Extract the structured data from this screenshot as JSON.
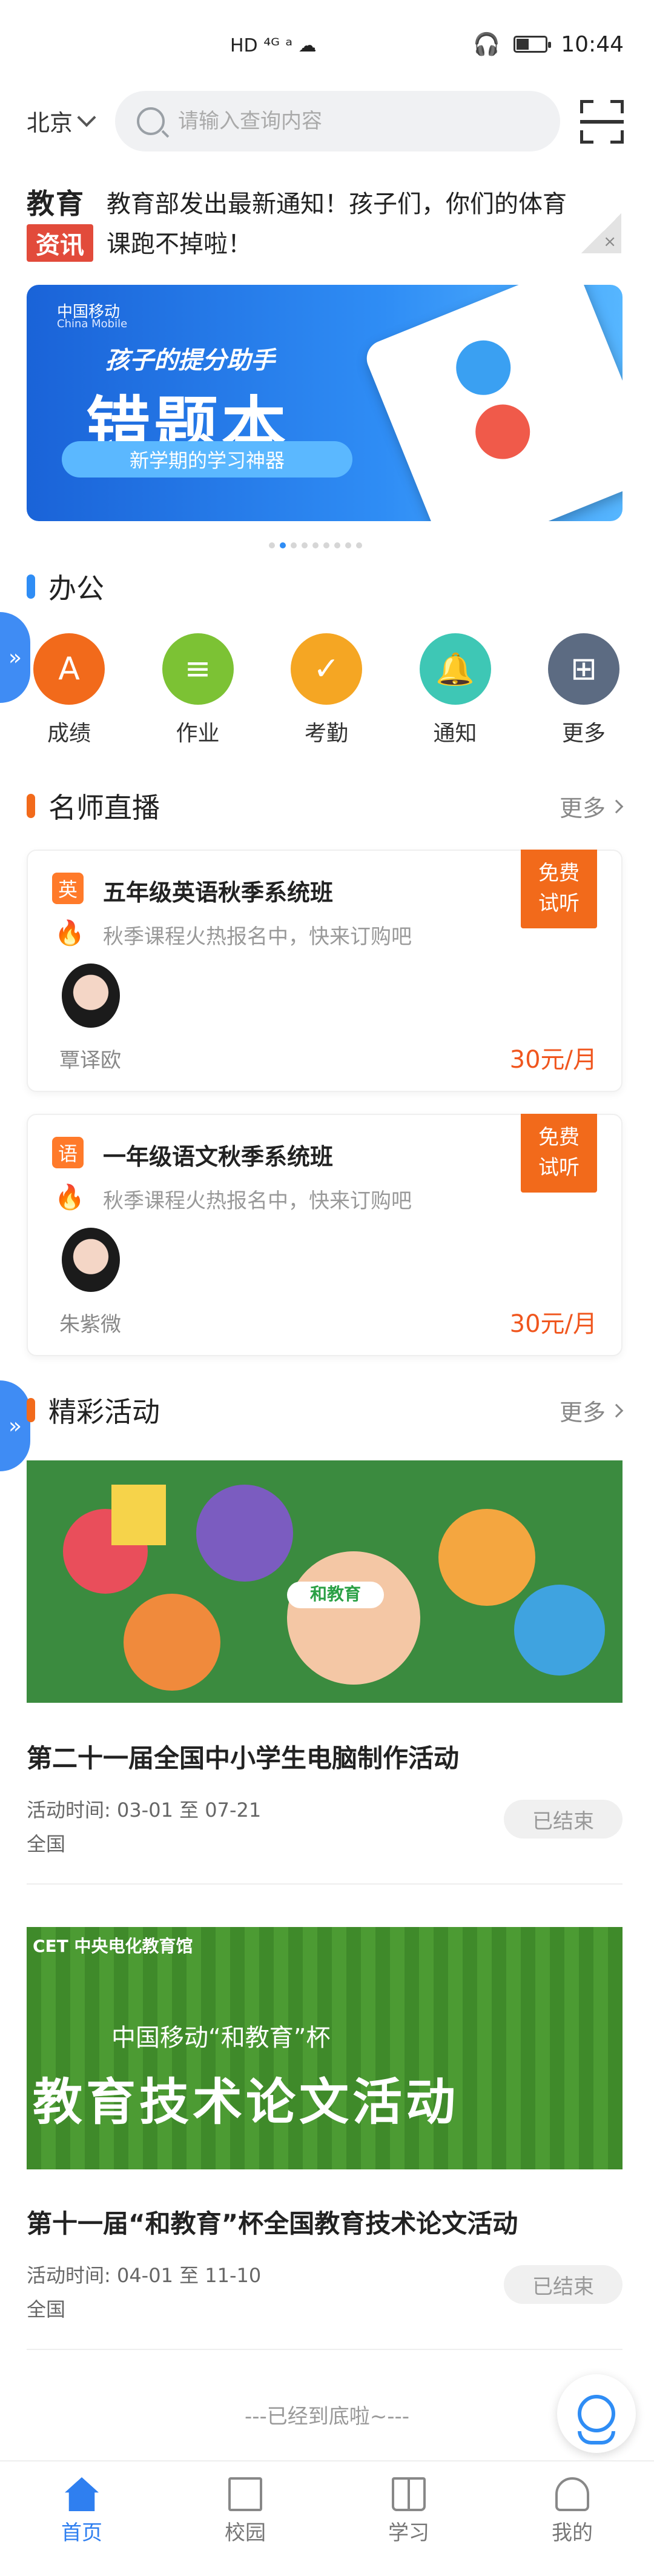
{
  "status_bar": {
    "left_icons": "HD ⁴ᴳ ᵃ ☁",
    "time": "10:44"
  },
  "header": {
    "city": "北京",
    "search_placeholder": "请输入查询内容"
  },
  "news": {
    "logo_top": "教育",
    "logo_bottom": "资讯",
    "text": "教育部发出最新通知！孩子们，你们的体育课跑不掉啦！",
    "close": "×"
  },
  "banner": {
    "brand": "中国移动",
    "brand_en": "China Mobile",
    "slogan": "孩子的提分助手",
    "title": "错题本",
    "pill": "新学期的学习神器",
    "dot_count": 9,
    "active_dot": 1
  },
  "office": {
    "title": "办公",
    "side_tab": "»",
    "items": [
      {
        "label": "成绩",
        "icon": "grade-icon",
        "color": "#f26a1b",
        "glyph": "A"
      },
      {
        "label": "作业",
        "icon": "homework-icon",
        "color": "#7cc234",
        "glyph": "≡"
      },
      {
        "label": "考勤",
        "icon": "attendance-icon",
        "color": "#f5a623",
        "glyph": "✓"
      },
      {
        "label": "通知",
        "icon": "bell-icon",
        "color": "#3ec7b5",
        "glyph": "🔔"
      },
      {
        "label": "更多",
        "icon": "more-grid-icon",
        "color": "#5c6b82",
        "glyph": "⊞"
      }
    ]
  },
  "live": {
    "title": "名师直播",
    "more": "更多",
    "cards": [
      {
        "subject": "英",
        "title": "五年级英语秋季系统班",
        "desc": "秋季课程火热报名中，快来订购吧",
        "teacher": "覃译欧",
        "price": "30元/月",
        "badge_line1": "免费",
        "badge_line2": "试听"
      },
      {
        "subject": "语",
        "title": "一年级语文秋季系统班",
        "desc": "秋季课程火热报名中，快来订购吧",
        "teacher": "朱紫微",
        "price": "30元/月",
        "badge_line1": "免费",
        "badge_line2": "试听"
      }
    ]
  },
  "activities": {
    "title": "精彩活动",
    "more": "更多",
    "side_tab": "»",
    "items": [
      {
        "title": "第二十一届全国中小学生电脑制作活动",
        "time": "活动时间: 03-01 至 07-21",
        "area": "全国",
        "status": "已结束",
        "image_text": "和教育"
      },
      {
        "title": "第十一届“和教育”杯全国教育技术论文活动",
        "time": "活动时间: 04-01 至 11-10",
        "area": "全国",
        "status": "已结束",
        "image_brand": "CET 中央电化教育馆",
        "image_sub": "中国移动“和教育”杯",
        "image_main": "教育技术论文活动"
      }
    ]
  },
  "footer_note": "---已经到底啦~---",
  "tabbar": {
    "items": [
      {
        "label": "首页",
        "active": true
      },
      {
        "label": "校园",
        "active": false
      },
      {
        "label": "学习",
        "active": false
      },
      {
        "label": "我的",
        "active": false
      }
    ]
  },
  "colors": {
    "accent": "#2f7ff0",
    "orange": "#f26a1b",
    "price": "#f0561e"
  }
}
